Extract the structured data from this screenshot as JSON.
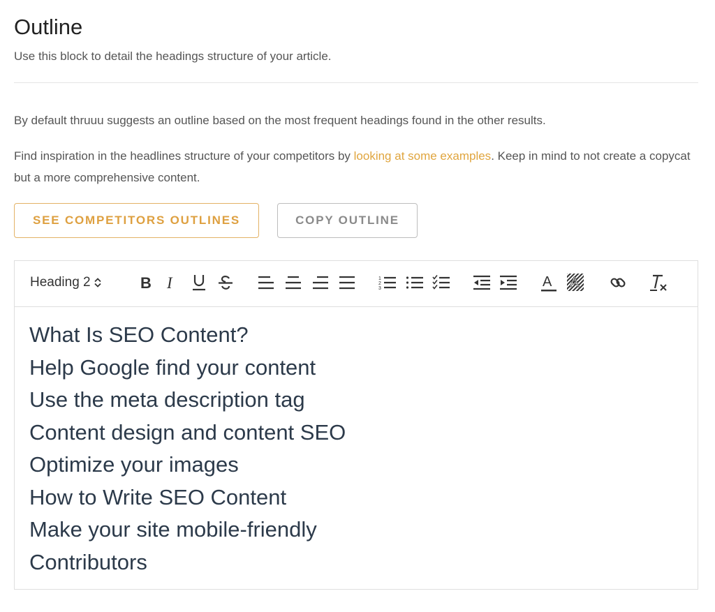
{
  "header": {
    "title": "Outline",
    "subtitle": "Use this block to detail the headings structure of your article."
  },
  "intro": {
    "paragraph1": "By default thruuu suggests an outline based on the most frequent headings found in the other results.",
    "paragraph2_before": "Find inspiration in the headlines structure of your competitors by ",
    "paragraph2_link": "looking at some examples",
    "paragraph2_after": ". Keep in mind to not create a copycat but a more comprehensive content."
  },
  "buttons": {
    "see_competitors": "SEE COMPETITORS OUTLINES",
    "copy_outline": "COPY OUTLINE"
  },
  "toolbar": {
    "heading_select": "Heading 2",
    "tools": [
      "bold-icon",
      "italic-icon",
      "underline-icon",
      "strikethrough-icon",
      "align-left-icon",
      "align-center-icon",
      "align-right-icon",
      "align-justify-icon",
      "ordered-list-icon",
      "bullet-list-icon",
      "checklist-icon",
      "outdent-icon",
      "indent-icon",
      "text-color-icon",
      "background-color-icon",
      "link-icon",
      "clear-format-icon"
    ]
  },
  "outline": [
    "What Is SEO Content?",
    "Help Google find your content",
    "Use the meta description tag",
    "Content design and content SEO",
    "Optimize your images",
    "How to Write SEO Content",
    "Make your site mobile-friendly",
    "Contributors"
  ],
  "colors": {
    "accent": "#dea040",
    "heading_text": "#2c3a4a",
    "muted_text": "#555555"
  }
}
